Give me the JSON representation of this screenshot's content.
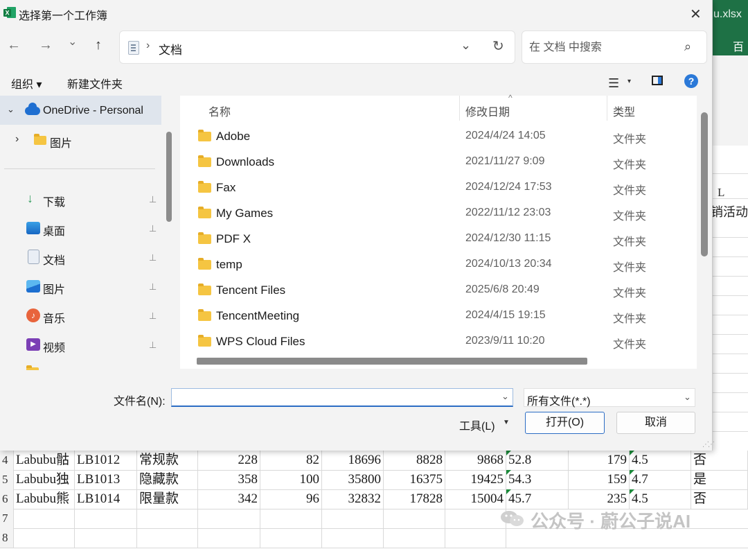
{
  "background": {
    "file_suffix": "u.xlsx",
    "ribbon_tab": "百度",
    "col_letter": "L",
    "row_text": "销活动",
    "rows": [
      {
        "n": "4",
        "name": "Labubu骷",
        "code": "LB1012",
        "kind": "常规款",
        "c1": "228",
        "c2": "82",
        "c3": "18696",
        "c4": "8828",
        "c5": "9868",
        "c6": "52.8",
        "c7": "179",
        "c8": "4.5",
        "c9": "否"
      },
      {
        "n": "5",
        "name": "Labubu独",
        "code": "LB1013",
        "kind": "隐藏款",
        "c1": "358",
        "c2": "100",
        "c3": "35800",
        "c4": "16375",
        "c5": "19425",
        "c6": "54.3",
        "c7": "159",
        "c8": "4.7",
        "c9": "是"
      },
      {
        "n": "6",
        "name": "Labubu熊",
        "code": "LB1014",
        "kind": "限量款",
        "c1": "342",
        "c2": "96",
        "c3": "32832",
        "c4": "17828",
        "c5": "15004",
        "c6": "45.7",
        "c7": "235",
        "c8": "4.5",
        "c9": "否"
      },
      {
        "n": "7"
      },
      {
        "n": "8"
      }
    ],
    "watermark": "公众号 · 蔚公子说AI"
  },
  "dialog": {
    "title": "选择第一个工作簿",
    "close": "✕",
    "nav": {
      "back": "←",
      "forward": "→",
      "recent": "⌄",
      "up": "↑"
    },
    "address": {
      "sep": "›",
      "path": "文档",
      "chevron": "⌄",
      "refresh": "↻"
    },
    "search": {
      "placeholder": "在 文档 中搜索",
      "icon": "⌕"
    },
    "toolbar": {
      "organize": "组织 ▾",
      "new_folder": "新建文件夹",
      "view": "☰",
      "view_caret": "▾",
      "help": "?"
    },
    "nav_pane": {
      "onedrive": {
        "chevron": "⌄",
        "label": "OneDrive - Personal"
      },
      "pictures_sub": {
        "chevron": "›",
        "label": "图片"
      },
      "quick": [
        {
          "label": "下载",
          "icon": "↓",
          "pin": "📌"
        },
        {
          "label": "桌面",
          "icon": "",
          "pin": "📌"
        },
        {
          "label": "文档",
          "icon": "",
          "pin": "📌"
        },
        {
          "label": "图片",
          "icon": "",
          "pin": "📌"
        },
        {
          "label": "音乐",
          "icon": "♪",
          "pin": "📌"
        },
        {
          "label": "视频",
          "icon": "▶",
          "pin": "📌"
        }
      ]
    },
    "columns": {
      "name": "名称",
      "date": "修改日期",
      "type": "类型",
      "sort": "^"
    },
    "files": [
      {
        "name": "Adobe",
        "date": "2024/4/24 14:05",
        "type": "文件夹"
      },
      {
        "name": "Downloads",
        "date": "2021/11/27 9:09",
        "type": "文件夹"
      },
      {
        "name": "Fax",
        "date": "2024/12/24 17:53",
        "type": "文件夹"
      },
      {
        "name": "My Games",
        "date": "2022/11/12 23:03",
        "type": "文件夹"
      },
      {
        "name": "PDF X",
        "date": "2024/12/30 11:15",
        "type": "文件夹"
      },
      {
        "name": "temp",
        "date": "2024/10/13 20:34",
        "type": "文件夹"
      },
      {
        "name": "Tencent Files",
        "date": "2025/6/8 20:49",
        "type": "文件夹"
      },
      {
        "name": "TencentMeeting",
        "date": "2024/4/15 19:15",
        "type": "文件夹"
      },
      {
        "name": "WPS Cloud Files",
        "date": "2023/9/11 10:20",
        "type": "文件夹"
      }
    ],
    "filename": {
      "label": "文件名(N):",
      "value": "",
      "chevron": "⌄"
    },
    "filter": {
      "value": "所有文件(*.*)",
      "chevron": "⌄"
    },
    "tools": {
      "label": "工具(L)",
      "caret": "▼"
    },
    "open_button": "打开(O)",
    "cancel_button": "取消",
    "colors": {
      "accent": "#2b6cc4",
      "folder": "#f5c542",
      "excel_green": "#1e7145",
      "selected": "#dfe5ed"
    }
  }
}
